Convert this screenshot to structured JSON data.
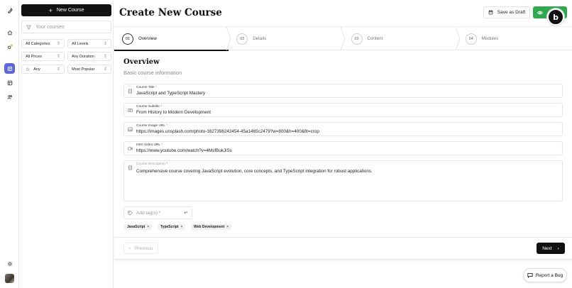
{
  "sidebar": {
    "new_course_label": "New Course",
    "search_placeholder": "Your courses",
    "filters": {
      "category": "All Categories",
      "level": "All Levels",
      "price": "All Prices",
      "duration": "Any Duration",
      "rating": "Any",
      "sort": "Most Popular"
    }
  },
  "header": {
    "title": "Create New Course",
    "save_draft_label": "Save as Draft",
    "avatar_letter": "b"
  },
  "steps": [
    {
      "num": "01",
      "label": "Overview"
    },
    {
      "num": "02",
      "label": "Details"
    },
    {
      "num": "03",
      "label": "Content"
    },
    {
      "num": "04",
      "label": "Modules"
    }
  ],
  "section": {
    "title": "Overview",
    "subtitle": "Basic course information"
  },
  "fields": {
    "title": {
      "label": "Course Title",
      "req": "*",
      "value": "JavaScript and TypeScript Mastery"
    },
    "subtitle": {
      "label": "Course Subtitle",
      "req": "*",
      "value": "From History to Modern Development"
    },
    "image": {
      "label": "Course Image URL",
      "req": "*",
      "value": "https://images.unsplash.com/photo-1627398242454-45a1465c2479?w=800&h=400&fit=crop"
    },
    "video": {
      "label": "Intro Video URL",
      "req": "*",
      "value": "https://www.youtube.com/watch?v=4MsfBokJiSs"
    },
    "description": {
      "label": "Course Description",
      "req": "*",
      "value": "Comprehensive course covering JavaScript evolution, core concepts, and TypeScript integration for robust applications."
    }
  },
  "tags": {
    "placeholder": "Add tag(s) *",
    "items": [
      "JavaScript",
      "TypeScript",
      "Web Development"
    ]
  },
  "nav": {
    "previous_label": "Previous",
    "next_label": "Next"
  },
  "report_bug_label": "Report a Bug",
  "colors": {
    "accent_green": "#2fa84f",
    "active_rail": "#5c67d8",
    "primary_dark": "#111111"
  }
}
